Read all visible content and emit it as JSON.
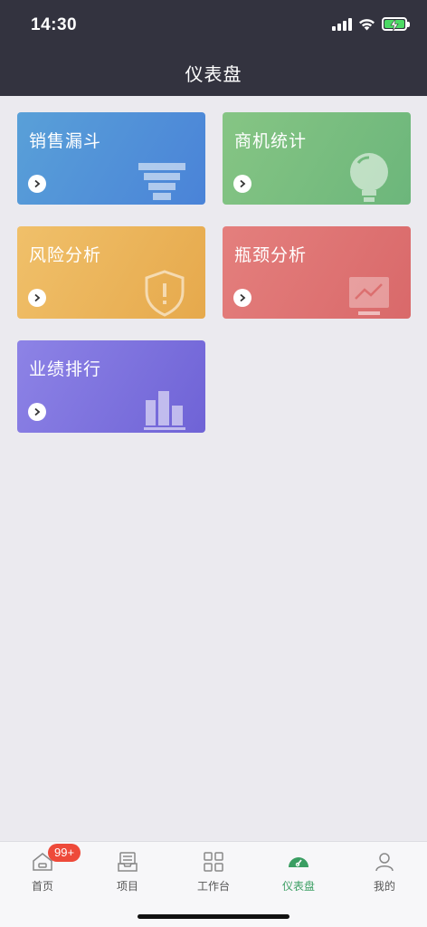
{
  "status": {
    "time": "14:30"
  },
  "header": {
    "title": "仪表盘"
  },
  "cards": [
    {
      "label": "销售漏斗",
      "icon": "funnel-icon",
      "color": "#4f8ad8"
    },
    {
      "label": "商机统计",
      "icon": "lightbulb-icon",
      "color": "#74bb7e"
    },
    {
      "label": "风险分析",
      "icon": "shield-icon",
      "color": "#e9b457"
    },
    {
      "label": "瓶颈分析",
      "icon": "monitor-chart-icon",
      "color": "#dd7272"
    },
    {
      "label": "业绩排行",
      "icon": "bar-chart-icon",
      "color": "#776bdb"
    }
  ],
  "tabbar": {
    "badge": "99+",
    "items": [
      {
        "label": "首页",
        "icon": "home-icon"
      },
      {
        "label": "项目",
        "icon": "inbox-icon"
      },
      {
        "label": "工作台",
        "icon": "grid-icon"
      },
      {
        "label": "仪表盘",
        "icon": "dashboard-icon",
        "active": true
      },
      {
        "label": "我的",
        "icon": "user-icon"
      }
    ]
  },
  "colors": {
    "accent": "#3a9e62",
    "header_bg": "#33333f",
    "badge": "#ee4a3a"
  }
}
